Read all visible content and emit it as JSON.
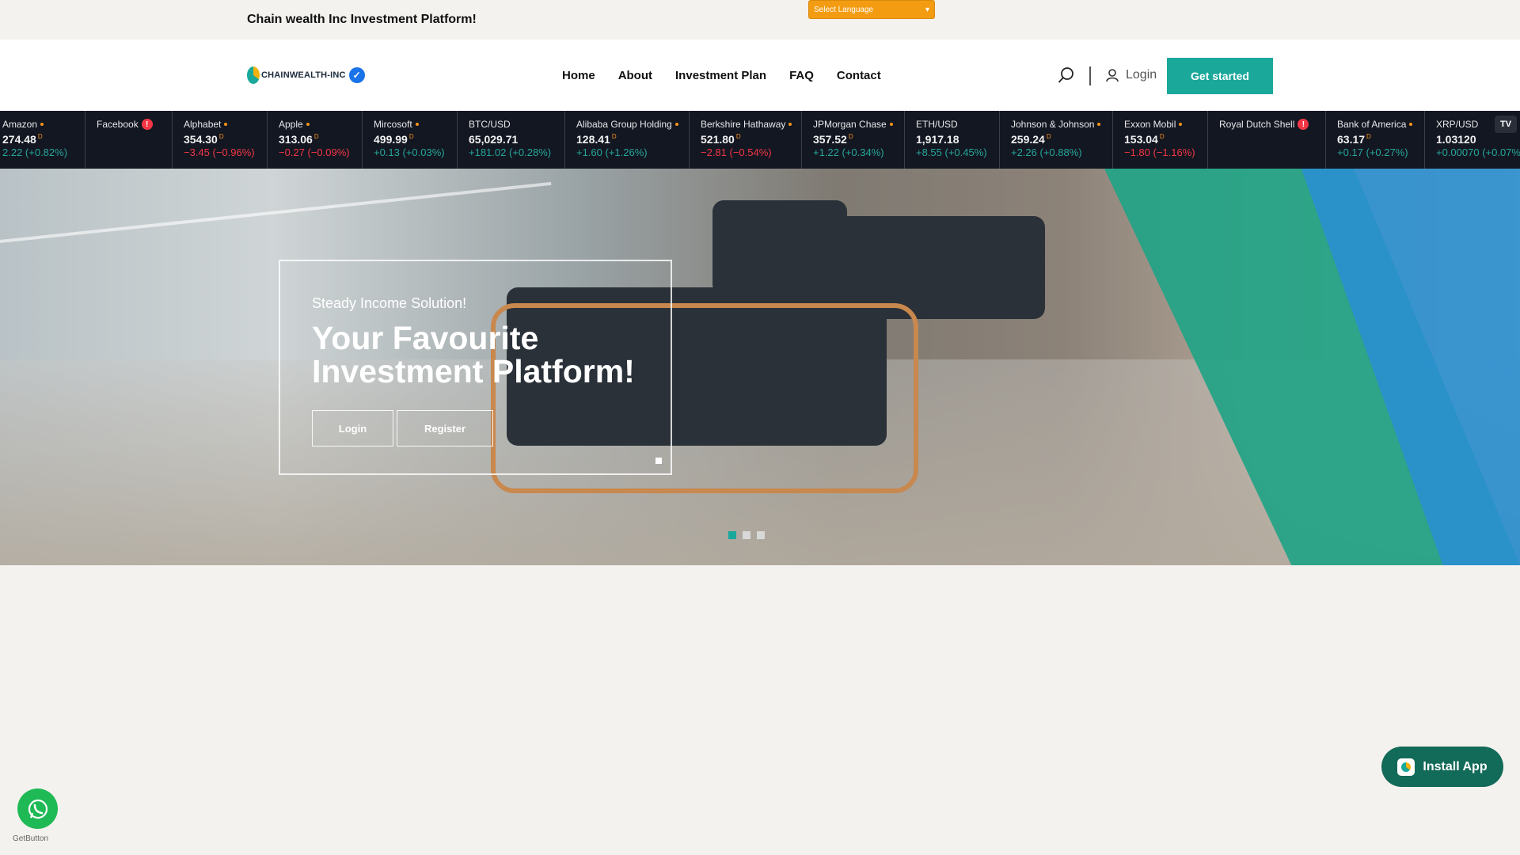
{
  "topbar": {
    "title": "Chain wealth Inc Investment Platform!",
    "language_select": "Select Language"
  },
  "header": {
    "logo_text": "CHAINWEALTH-INC",
    "nav": [
      "Home",
      "About",
      "Investment Plan",
      "FAQ",
      "Contact"
    ],
    "login_label": "Login",
    "cta_label": "Get started"
  },
  "ticker": [
    {
      "name": "Amazon",
      "flag": "dot",
      "price": "274.48",
      "sup": "D",
      "change": "2.22 (+0.82%)",
      "dir": "up"
    },
    {
      "name": "Facebook",
      "flag": "warn",
      "price": "",
      "sup": "",
      "change": "",
      "dir": "up"
    },
    {
      "name": "Alphabet",
      "flag": "dot",
      "price": "354.30",
      "sup": "D",
      "change": "−3.45 (−0.96%)",
      "dir": "down"
    },
    {
      "name": "Apple",
      "flag": "dot",
      "price": "313.06",
      "sup": "D",
      "change": "−0.27 (−0.09%)",
      "dir": "down"
    },
    {
      "name": "Mircosoft",
      "flag": "dot",
      "price": "499.99",
      "sup": "D",
      "change": "+0.13 (+0.03%)",
      "dir": "up"
    },
    {
      "name": "BTC/USD",
      "flag": "",
      "price": "65,029.71",
      "sup": "",
      "change": "+181.02 (+0.28%)",
      "dir": "up"
    },
    {
      "name": "Alibaba Group Holding",
      "flag": "dot",
      "price": "128.41",
      "sup": "D",
      "change": "+1.60 (+1.26%)",
      "dir": "up"
    },
    {
      "name": "Berkshire Hathaway",
      "flag": "dot",
      "price": "521.80",
      "sup": "D",
      "change": "−2.81 (−0.54%)",
      "dir": "down"
    },
    {
      "name": "JPMorgan Chase",
      "flag": "dot",
      "price": "357.52",
      "sup": "D",
      "change": "+1.22 (+0.34%)",
      "dir": "up"
    },
    {
      "name": "ETH/USD",
      "flag": "",
      "price": "1,917.18",
      "sup": "",
      "change": "+8.55 (+0.45%)",
      "dir": "up"
    },
    {
      "name": "Johnson & Johnson",
      "flag": "dot",
      "price": "259.24",
      "sup": "D",
      "change": "+2.26 (+0.88%)",
      "dir": "up"
    },
    {
      "name": "Exxon Mobil",
      "flag": "dot",
      "price": "153.04",
      "sup": "D",
      "change": "−1.80 (−1.16%)",
      "dir": "down"
    },
    {
      "name": "Royal Dutch Shell",
      "flag": "warn",
      "price": "",
      "sup": "",
      "change": "",
      "dir": "up"
    },
    {
      "name": "Bank of America",
      "flag": "dot",
      "price": "63.17",
      "sup": "D",
      "change": "+0.17 (+0.27%)",
      "dir": "up"
    },
    {
      "name": "XRP/USD",
      "flag": "",
      "price": "1.03120",
      "sup": "",
      "change": "+0.00070 (+0.07%",
      "dir": "up"
    }
  ],
  "hero": {
    "subtitle": "Steady Income Solution!",
    "title": "Your Favourite Investment Platform!",
    "login_button": "Login",
    "register_button": "Register"
  },
  "install_app": "Install App",
  "getbutton": "GetButton",
  "colors": {
    "accent": "#1aa89a",
    "ticker_bg": "#131722",
    "up": "#26a69a",
    "down": "#f23645",
    "language_bg": "#f39c12"
  }
}
